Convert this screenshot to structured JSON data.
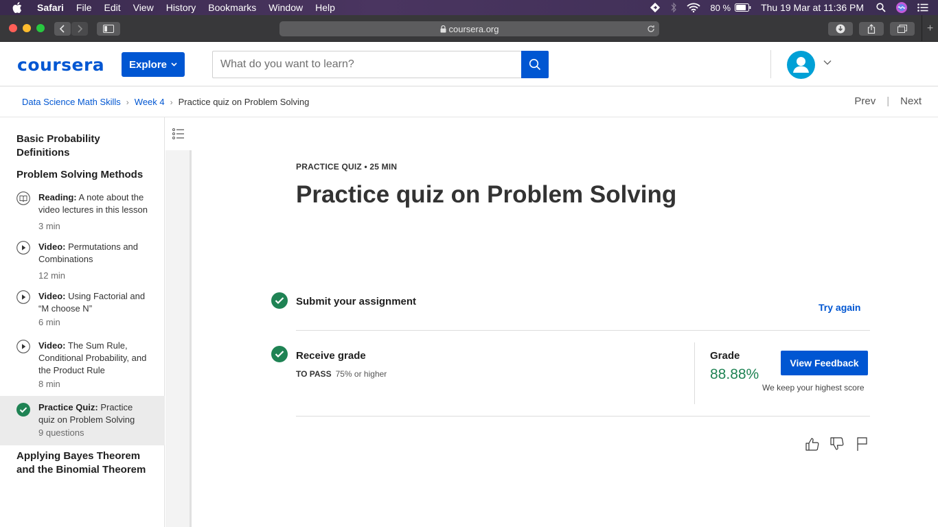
{
  "menubar": {
    "app": "Safari",
    "items": [
      "File",
      "Edit",
      "View",
      "History",
      "Bookmarks",
      "Window",
      "Help"
    ],
    "battery": "80 %",
    "datetime": "Thu 19 Mar at  11:36 PM"
  },
  "browser": {
    "url": "coursera.org"
  },
  "header": {
    "logo": "coursera",
    "explore_label": "Explore",
    "search_placeholder": "What do you want to learn?"
  },
  "breadcrumb": {
    "items": [
      "Data Science Math Skills",
      "Week 4"
    ],
    "current": "Practice quiz on Problem Solving",
    "prev": "Prev",
    "next": "Next"
  },
  "sidebar": {
    "section1": "Basic Probability Definitions",
    "section2": "Problem Solving Methods",
    "items": [
      {
        "type": "Reading:",
        "title": "A note about the video lectures in this lesson",
        "duration": "3 min",
        "icon": "reading-icon"
      },
      {
        "type": "Video:",
        "title": "Permutations and Combinations",
        "duration": "12 min",
        "icon": "play-icon"
      },
      {
        "type": "Video:",
        "title": "Using Factorial and “M choose N”",
        "duration": "6 min",
        "icon": "play-icon"
      },
      {
        "type": "Video:",
        "title": "The Sum Rule, Conditional Probability, and the Product Rule",
        "duration": "8 min",
        "icon": "play-icon"
      },
      {
        "type": "Practice Quiz:",
        "title": "Practice quiz on Problem Solving",
        "duration": "9 questions",
        "icon": "check-icon"
      }
    ],
    "section3": "Applying Bayes Theorem and the Binomial Theorem"
  },
  "main": {
    "kicker": "PRACTICE QUIZ • 25 MIN",
    "title": "Practice quiz on Problem Solving",
    "submit_label": "Submit your assignment",
    "try_again": "Try again",
    "receive_label": "Receive grade",
    "to_pass_label": "TO PASS",
    "to_pass_value": "75% or higher",
    "grade_label": "Grade",
    "grade_value": "88.88%",
    "feedback_button": "View Feedback",
    "keep_note": "We keep your highest score"
  },
  "colors": {
    "brand": "#0056d2",
    "success": "#1f8354"
  }
}
